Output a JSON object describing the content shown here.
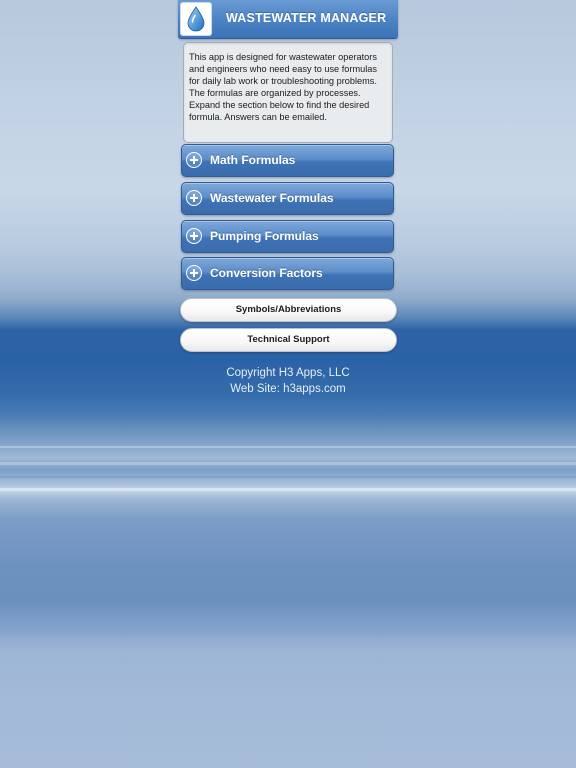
{
  "header": {
    "title": "WASTEWATER MANAGER",
    "icon": "water-drop-icon"
  },
  "description": {
    "text": "This app is designed for wastewater operators and engineers who need easy to use formulas for daily lab work or troubleshooting problems. The formulas are organized by processes. Expand the section below to find the desired formula. Answers can be emailed."
  },
  "sections": [
    {
      "label": "Math Formulas",
      "icon": "plus-circle-icon"
    },
    {
      "label": "Wastewater Formulas",
      "icon": "plus-circle-icon"
    },
    {
      "label": "Pumping Formulas",
      "icon": "plus-circle-icon"
    },
    {
      "label": "Conversion Factors",
      "icon": "plus-circle-icon"
    }
  ],
  "buttons": {
    "symbols": "Symbols/Abbreviations",
    "support": "Technical Support"
  },
  "footer": {
    "copyright": "Copyright H3 Apps, LLC",
    "website": "Web Site: h3apps.com"
  },
  "colors": {
    "header_blue": "#4a82c4",
    "section_blue": "#4f82c2",
    "background_blue": "#2d63a6"
  }
}
